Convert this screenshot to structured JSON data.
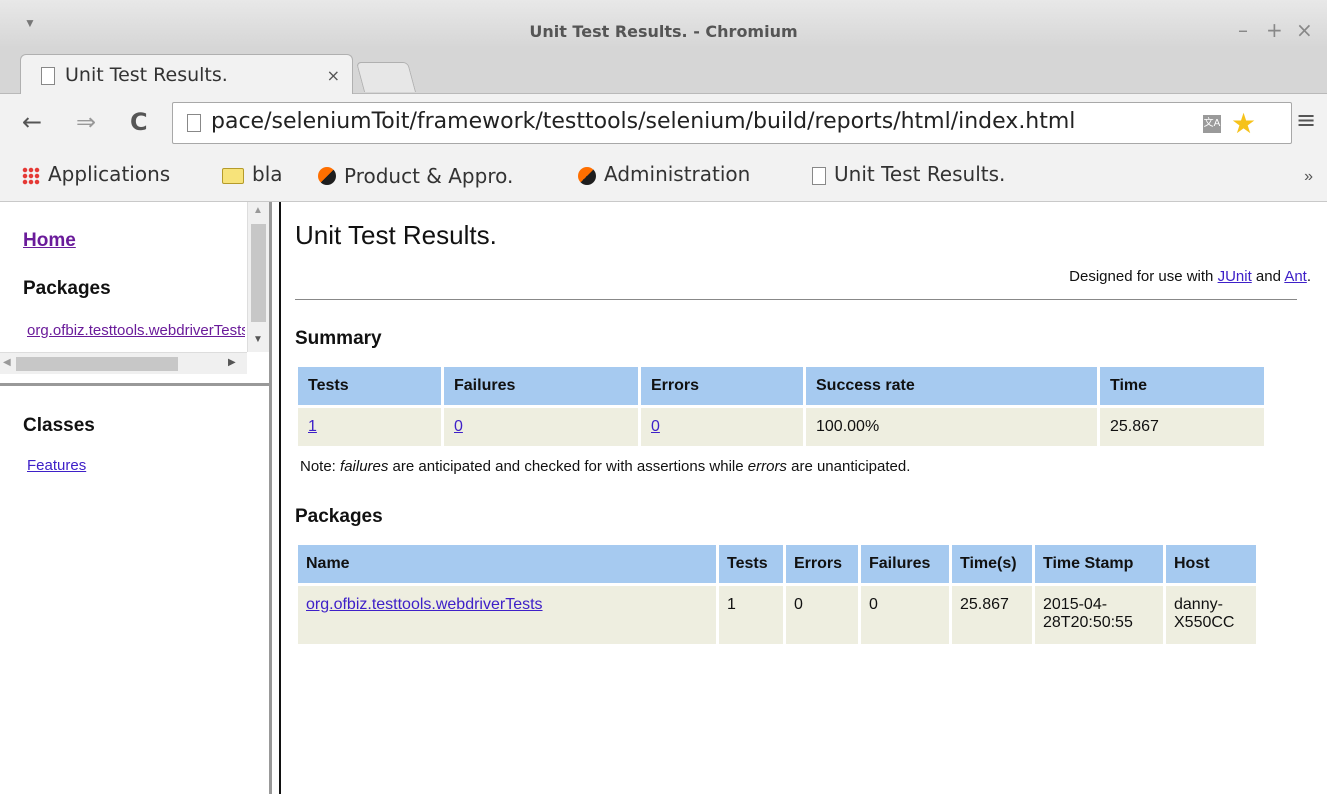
{
  "window": {
    "title": "Unit Test Results. - Chromium",
    "controls": {
      "minimize": "–",
      "maximize": "+",
      "close": "×"
    }
  },
  "tab": {
    "label": "Unit Test Results.",
    "close": "×"
  },
  "toolbar": {
    "back": "←",
    "forward": "⇒",
    "reload": "C",
    "url": "pace/seleniumToit/framework/testtools/selenium/build/reports/html/index.html",
    "menu": "≡"
  },
  "bookmarks": [
    {
      "label": "Applications",
      "icon": "apps-icon"
    },
    {
      "label": "bla",
      "icon": "folder-icon"
    },
    {
      "label": "Product & Appro.",
      "icon": "favicon-icon"
    },
    {
      "label": "Administration",
      "icon": "favicon-icon"
    },
    {
      "label": "Unit Test Results.",
      "icon": "page-icon"
    }
  ],
  "bookmarks_overflow": "»",
  "left": {
    "home": "Home",
    "packages_heading": "Packages",
    "package_link": "org.ofbiz.testtools.webdriverTests",
    "classes_heading": "Classes",
    "class_link": "Features"
  },
  "main": {
    "title": "Unit Test Results.",
    "designed_prefix": "Designed for use with ",
    "junit": "JUnit",
    "and": " and ",
    "ant": "Ant",
    "period": ".",
    "summary_heading": "Summary",
    "summary": {
      "headers": [
        "Tests",
        "Failures",
        "Errors",
        "Success rate",
        "Time"
      ],
      "tests": "1",
      "failures": "0",
      "errors": "0",
      "success_rate": "100.00%",
      "time": "25.867"
    },
    "note": {
      "prefix": "Note: ",
      "failures": "failures",
      "middle": " are anticipated and checked for with assertions while ",
      "errors": "errors",
      "suffix": " are unanticipated."
    },
    "packages_heading": "Packages",
    "packages": {
      "headers": [
        "Name",
        "Tests",
        "Errors",
        "Failures",
        "Time(s)",
        "Time Stamp",
        "Host"
      ],
      "row": {
        "name": "org.ofbiz.testtools.webdriverTests",
        "tests": "1",
        "errors": "0",
        "failures": "0",
        "time": "25.867",
        "timestamp_1": "2015-04-",
        "timestamp_2": "28T20:50:55",
        "host_1": "danny-",
        "host_2": "X550CC"
      }
    }
  }
}
